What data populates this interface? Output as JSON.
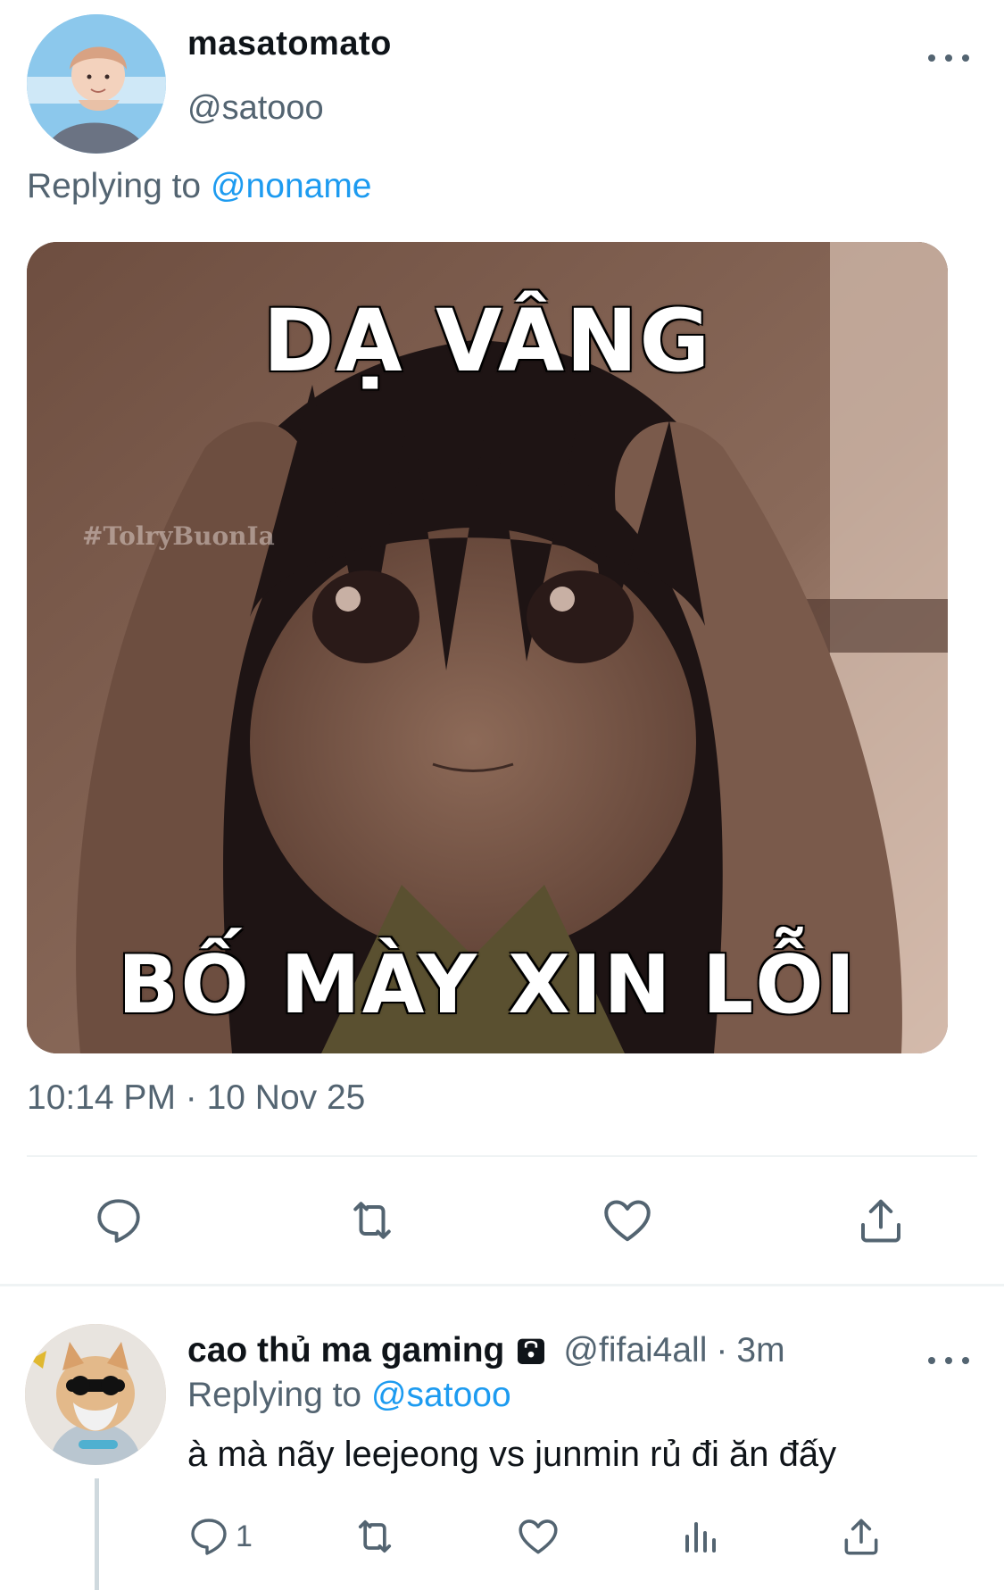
{
  "tweet": {
    "display_name": "masatomato",
    "handle": "@satooo",
    "replying_prefix": "Replying to",
    "replying_to": "@noname",
    "media": {
      "top_text": "DẠ VÂNG",
      "bottom_text": "BỐ MÀY XIN LỖI",
      "watermark": "#TolryBuonIa"
    },
    "timestamp": "10:14 PM · 10 Nov 25",
    "actions": [
      "reply-icon",
      "retweet-icon",
      "like-icon",
      "share-icon"
    ]
  },
  "reply": {
    "display_name": "cao thủ ma gaming",
    "handle": "@fifai4all",
    "separator": "·",
    "time": "3m",
    "replying_prefix": "Replying to",
    "replying_to": "@satooo",
    "text": "à mà nãy leejeong vs junmin rủ đi ăn đấy",
    "reply_count": "1",
    "actions": [
      "reply-icon",
      "retweet-icon",
      "like-icon",
      "analytics-icon",
      "share-icon"
    ]
  },
  "colors": {
    "text": "#0f1419",
    "secondary": "#536471",
    "link": "#1d9bf0",
    "divider": "#eff3f4"
  }
}
